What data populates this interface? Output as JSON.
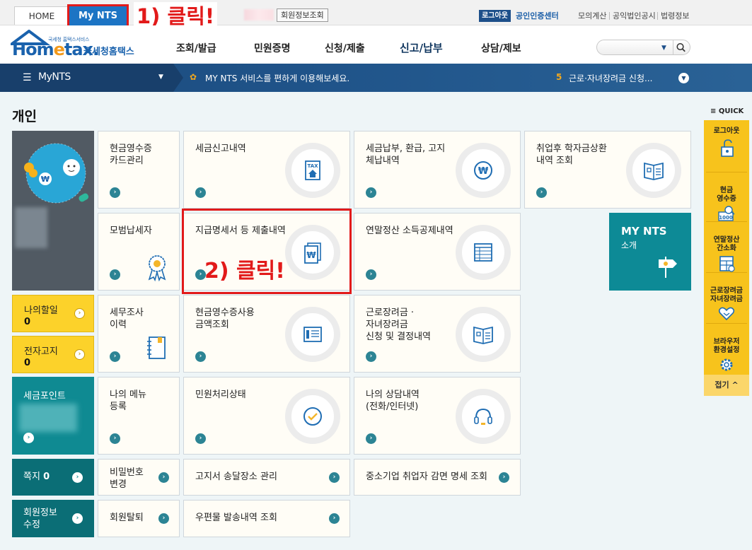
{
  "topbar": {
    "home": "HOME",
    "my_nts": "My NTS",
    "member_info_btn": "회원정보조회",
    "logout": "로그아웃",
    "cert_center": "공인인증센터",
    "links": [
      "모의계산",
      "공익법인공시",
      "법령정보"
    ]
  },
  "annotations": {
    "step1": "1) 클릭!",
    "step2": "2) 클릭!"
  },
  "header": {
    "logo_small": "국세청 홈택스서비스",
    "logo_main_1": "Hom",
    "logo_main_e": "e",
    "logo_main_2": "tax.",
    "logo_korean": "국세청홈택스",
    "menu": [
      "조회/발급",
      "민원증명",
      "신청/제출",
      "신고/납부",
      "상담/제보"
    ]
  },
  "navbar": {
    "title": "MyNTS",
    "notice": "MY NTS 서비스를 편하게 이용해보세요.",
    "news_num": "5",
    "news_text": "근로·자녀장려금 신청..."
  },
  "page_title": "개인",
  "cards": {
    "cash_receipt_card": "현금영수증\n카드관리",
    "tax_report_history": "세금신고내역",
    "tax_payment": "세금납부, 환급, 고지\n체납내역",
    "student_loan": "취업후 학자금상환\n내역 조회",
    "model_taxpayer": "모범납세자",
    "payment_statement": "지급명세서 등 제출내역",
    "year_end_deduction": "연말정산 소득공제내역",
    "tax_audit": "세무조사\n이력",
    "cash_receipt_amount": "현금영수증사용\n금액조회",
    "incentive": "근로장려금 ·\n자녀장려금\n신청 및 결정내역",
    "my_menu": "나의 메뉴\n등록",
    "civil_status": "민원처리상태",
    "consult_history": "나의 상담내역\n(전화/인터넷)",
    "password_change": "비밀번호\n변경",
    "bill_delivery": "고지서 송달장소 관리",
    "sme_reduction": "중소기업 취업자 감면 명세 조회",
    "withdraw": "회원탈퇴",
    "mail_history": "우편물 발송내역 조회"
  },
  "side": {
    "todo_label": "나의할일",
    "todo_count": "0",
    "ebill_label": "전자고지",
    "ebill_count": "0",
    "tax_point_label": "세금포인트",
    "note_label": "쪽지",
    "note_count": "0",
    "member_edit": "회원정보\n수정"
  },
  "mynts_intro": {
    "title": "MY NTS",
    "subtitle": "소개"
  },
  "quick": {
    "label": "QUICK",
    "items": [
      "로그아웃",
      "현금\n영수증",
      "연말정산\n간소화",
      "근로장려금\n자녀장려금",
      "브라우저\n환경설정"
    ],
    "fold": "접기"
  },
  "colors": {
    "brand_blue": "#1c74c4",
    "annotation_red": "#e21a1a",
    "teal": "#0f8a92",
    "quick_yellow": "#f7c31c"
  }
}
